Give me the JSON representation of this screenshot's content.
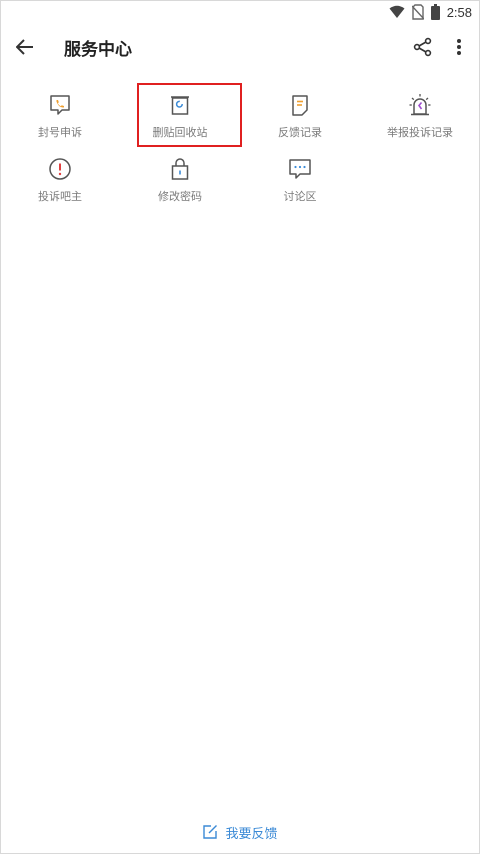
{
  "status_bar": {
    "time": "2:58"
  },
  "app_bar": {
    "title": "服务中心"
  },
  "services": {
    "row1": [
      {
        "label": "封号申诉",
        "icon": "phone-bubble-icon"
      },
      {
        "label": "删贴回收站",
        "icon": "recycle-bin-icon"
      },
      {
        "label": "反馈记录",
        "icon": "note-icon"
      },
      {
        "label": "举报投诉记录",
        "icon": "alarm-icon"
      }
    ],
    "row2": [
      {
        "label": "投诉吧主",
        "icon": "exclamation-icon"
      },
      {
        "label": "修改密码",
        "icon": "lock-icon"
      },
      {
        "label": "讨论区",
        "icon": "chat-icon"
      }
    ]
  },
  "feedback": {
    "label": "我要反馈"
  },
  "colors": {
    "accent_blue": "#3b8ad6",
    "highlight_red": "#e02020",
    "icon_orange": "#f0a030"
  }
}
